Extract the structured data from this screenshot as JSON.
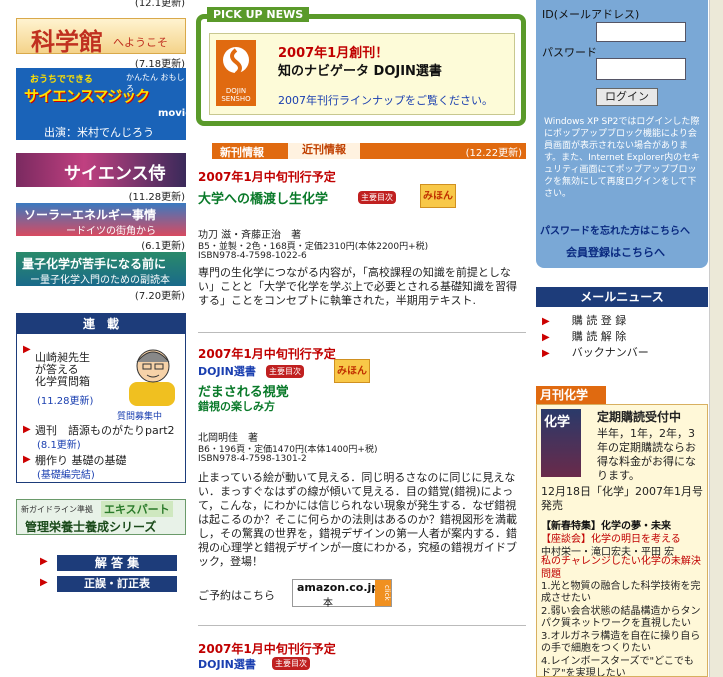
{
  "left": {
    "top_update": "(12.1更新)",
    "kagakukan_title": "科学館",
    "kagakukan_sub": "へようこそ",
    "kagakukan_update": "(7.18更新)",
    "magic_small": "おうちでできる",
    "magic_title": "サイエンスマジック",
    "magic_side": "かんたん おもしろ",
    "magic_movie": "movie",
    "magic_cast": "出演：米村でんじろう",
    "samurai_title": "サイエンス侍",
    "samurai_update": "(11.28更新)",
    "solar_title": "ソーラーエネルギー事情",
    "solar_sub": "ードイツの街角から",
    "solar_update": "(6.1更新)",
    "quantum_title": "量子化学が苦手になる前に",
    "quantum_sub": "ー量子化学入門のための副読本",
    "quantum_update": "(7.20更新)",
    "serial_header": "連　載",
    "yamazaki_text": "山崎昶先生\nが答える\n化学質問箱",
    "yamazaki_update": "(11.28更新)",
    "question_wanted": "質問募集中",
    "weekly_text": "週刊　語源ものがたりpart2",
    "weekly_update": "(8.1更新)",
    "tanatsukuri_text": "棚作り 基礎の基礎",
    "tanatsukuri_sub": "(基礎編完結)",
    "guide_small": "新ガイドライン準拠",
    "guide_expert": "エキスパート",
    "guide_series": "管理栄養士養成シリーズ",
    "answers_btn": "解 答 集",
    "errata_btn": "正誤・訂正表"
  },
  "pickup": {
    "header": "PICK UP NEWS",
    "logo_text": "DOJIN SENSHO",
    "headline_red": "2007年1月創刊！",
    "headline": "知のナビゲータ DOJIN選書",
    "lineup_link": "2007年刊行ラインナップをご覧ください。"
  },
  "tabs": {
    "new_label": "新刊情報",
    "recent_label": "近刊情報",
    "updated": "(12.22更新)"
  },
  "books": [
    {
      "date": "2007年1月中旬刊行予定",
      "series": "",
      "title": "大学への橋渡し生化学",
      "subtitle": "",
      "toc": "主要目次",
      "sample": "みほん",
      "authors": "功刀 滋・斉藤正治　著",
      "spec": "B5・並製・2色・168頁・定価2310円(本体2200円+税)",
      "isbn": "ISBN978-4-7598-1022-6",
      "desc": "専門の生化学につながる内容が，「高校課程の知識を前提としない」ことと「大学で化学を学ぶ上で必要とされる基礎知識を習得する」ことをコンセプトに執筆された，半期用テキスト."
    },
    {
      "date": "2007年1月中旬刊行予定",
      "series": "DOJIN選書",
      "title": "だまされる視覚",
      "subtitle": "錯視の楽しみ方",
      "toc": "主要目次",
      "sample": "みほん",
      "authors": "北岡明佳　著",
      "spec": "B6・196頁・定価1470円(本体1400円+税)",
      "isbn": "ISBN978-4-7598-1301-2",
      "desc": "止まっている絵が動いて見える．同じ明るさなのに同じに見えない．まっすぐなはずの線が傾いて見える．目の錯覚(錯視)によって，こんな，にわかには信じられない現象が発生する．なぜ錯視は起こるのか？そこに何らかの法則はあるのか？錯視図形を満載し，その驚異の世界を，錯視デザインの第一人者が案内する．錯視の心理学と錯視デザインが一度にわかる，究極の錯視ガイドブック，登場！",
      "order_text": "ご予約はこちら",
      "amazon_text": "amazon.co.jp",
      "amazon_sub": "本",
      "amazon_click": "click"
    },
    {
      "date": "2007年1月中旬刊行予定",
      "series": "DOJIN選書",
      "toc": "主要目次"
    }
  ],
  "right": {
    "id_label": "ID(メールアドレス)",
    "password_label": "パスワード",
    "login_btn": "ログイン",
    "notice": "Windows XP SP2ではログインした際にポップアップブロック機能により会員画面が表示されない場合があります。また、Internet Explorer内のセキュリティ画面にてポップアップブロックを無効にして再度ログインをして下さい。",
    "forgot_link": "パスワードを忘れた方はこちらへ",
    "register_link": "会員登録はこちらへ",
    "mailnews_header": "メールニュース",
    "mail_items": [
      "購 読 登 録",
      "購 読 解 除",
      "バックナンバー"
    ],
    "monthly_header": "月刊化学",
    "cover_title": "化学",
    "subscribe_title": "定期購読受付中",
    "subscribe_text": "半年，1年，2年，3年の定期購読ならお得な料金がお得になります。",
    "release_text": "12月18日「化学」2007年1月号発売",
    "feature_label": "【新春特集】化学の夢・未来",
    "feature_sub": "【座談会】化学の明日を考える",
    "feature_people": "中村栄一・滝口宏夫・平田 宏",
    "feature_challenge": "私のチャレンジしたい化学の未解決問題",
    "list": [
      "1.光と物質の融合した科学技術を完成させたい",
      "2.弱い会合状態の結晶構造からタンパク質ネットワークを直視したい",
      "3.オルガネラ構造を自在に操り自らの手で細胞をつくりたい",
      "4.レインボースターズで\"どこでもドア\"を実現したい"
    ]
  },
  "colors": {
    "accent_red": "#c00000",
    "pickup_green": "#5a9a2a",
    "login_panel": "#7aa8d6",
    "tab_orange": "#e06a10",
    "dark_blue": "#1d3c7a"
  }
}
